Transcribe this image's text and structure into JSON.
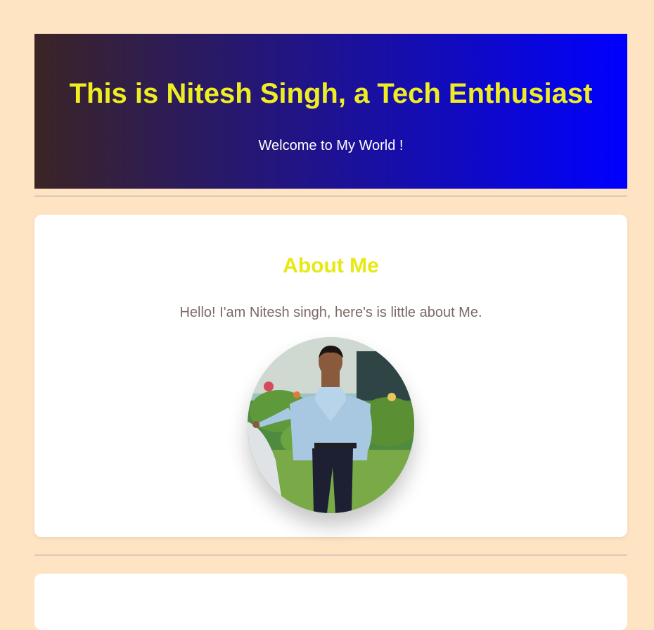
{
  "hero": {
    "title": "This is Nitesh Singh, a Tech Enthusiast",
    "subtitle": "Welcome to My World !"
  },
  "about": {
    "heading": "About Me",
    "text": "Hello! I'am Nitesh singh, here's is little about Me.",
    "photo_icon": "profile-photo"
  },
  "colors": {
    "page_background": "#ffe4c4",
    "hero_gradient_start": "#3b2424",
    "hero_gradient_end": "#0000ff",
    "title_yellow": "#eeee22",
    "card_background": "#ffffff",
    "body_text": "#7a6a66"
  }
}
